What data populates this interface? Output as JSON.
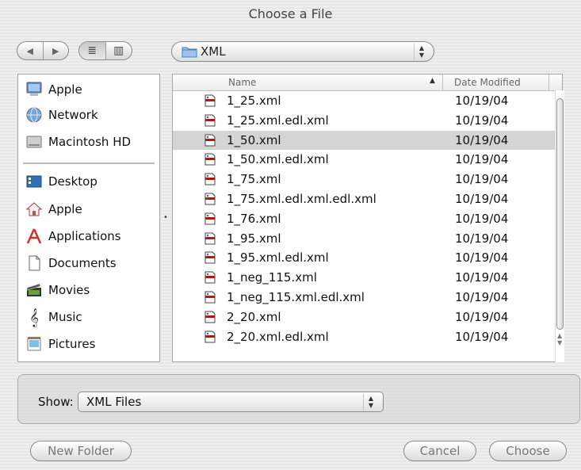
{
  "window": {
    "title": "Choose a File"
  },
  "toolbar": {
    "back_glyph": "◀",
    "forward_glyph": "▶",
    "list_view_glyph": "≣",
    "column_view_glyph": "▥",
    "path": "XML",
    "popup_up": "▲",
    "popup_down": "▼"
  },
  "sidebar": {
    "devices": [
      {
        "label": "Apple",
        "icon": "computer-icon"
      },
      {
        "label": "Network",
        "icon": "network-globe-icon"
      },
      {
        "label": "Macintosh HD",
        "icon": "hard-disk-icon"
      }
    ],
    "places": [
      {
        "label": "Desktop",
        "icon": "desktop-icon"
      },
      {
        "label": "Apple",
        "icon": "home-icon"
      },
      {
        "label": "Applications",
        "icon": "applications-icon"
      },
      {
        "label": "Documents",
        "icon": "documents-icon"
      },
      {
        "label": "Movies",
        "icon": "movies-icon"
      },
      {
        "label": "Music",
        "icon": "music-icon"
      },
      {
        "label": "Pictures",
        "icon": "pictures-icon"
      }
    ]
  },
  "splitter": {
    "glyph": "•"
  },
  "filelist": {
    "columns": {
      "name": "Name",
      "date": "Date Modified",
      "sort_glyph": "▲"
    },
    "rows": [
      {
        "name": "1_25.xml",
        "date": "10/19/04",
        "selected": false
      },
      {
        "name": "1_25.xml.edl.xml",
        "date": "10/19/04",
        "selected": false
      },
      {
        "name": "1_50.xml",
        "date": "10/19/04",
        "selected": true
      },
      {
        "name": "1_50.xml.edl.xml",
        "date": "10/19/04",
        "selected": false
      },
      {
        "name": "1_75.xml",
        "date": "10/19/04",
        "selected": false
      },
      {
        "name": "1_75.xml.edl.xml.edl.xml",
        "date": "10/19/04",
        "selected": false
      },
      {
        "name": "1_76.xml",
        "date": "10/19/04",
        "selected": false
      },
      {
        "name": "1_95.xml",
        "date": "10/19/04",
        "selected": false
      },
      {
        "name": "1_95.xml.edl.xml",
        "date": "10/19/04",
        "selected": false
      },
      {
        "name": "1_neg_115.xml",
        "date": "10/19/04",
        "selected": false
      },
      {
        "name": "1_neg_115.xml.edl.xml",
        "date": "10/19/04",
        "selected": false
      },
      {
        "name": "2_20.xml",
        "date": "10/19/04",
        "selected": false
      },
      {
        "name": "2_20.xml.edl.xml",
        "date": "10/19/04",
        "selected": false
      }
    ]
  },
  "show": {
    "label": "Show:",
    "value": "XML Files"
  },
  "buttons": {
    "new_folder": "New Folder",
    "cancel": "Cancel",
    "choose": "Choose"
  }
}
